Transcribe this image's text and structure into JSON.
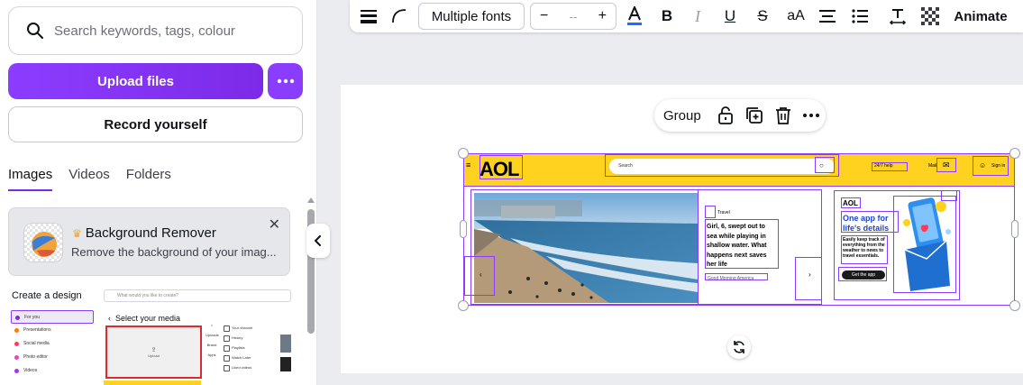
{
  "sidebar": {
    "search_placeholder": "Search keywords, tags, colour",
    "upload_label": "Upload files",
    "record_label": "Record yourself",
    "tabs": [
      {
        "label": "Images",
        "active": true
      },
      {
        "label": "Videos",
        "active": false
      },
      {
        "label": "Folders",
        "active": false
      }
    ],
    "bg_remover": {
      "title": "Background Remover",
      "description": "Remove the background of your imag..."
    },
    "preview": {
      "title": "Create a design",
      "search_placeholder": "What would you like to create?",
      "select_media": "Select your media",
      "upload_label": "Upload",
      "side_items": [
        "For you",
        "Presentations",
        "Social media",
        "Photo editor",
        "Videos"
      ],
      "side_colors": [
        "#7d2ae8",
        "#ff7a00",
        "#ff3b5c",
        "#e24bb3",
        "#ad34e3"
      ],
      "col2": [
        "Uploads",
        "Brand",
        "Apps"
      ],
      "col3": [
        "Your channel",
        "History",
        "Playlists",
        "Watch Later",
        "Liked videos"
      ]
    }
  },
  "toolbar": {
    "font": "Multiple fonts",
    "size_minus": "−",
    "size_value": "--",
    "size_plus": "+",
    "case_label": "aA",
    "animate_label": "Animate",
    "text_color": "#1d6cff"
  },
  "canvas": {
    "group_label": "Group",
    "aol": {
      "logo": "AOL",
      "search": "Search",
      "help": "24/7 help",
      "mail": "Mail",
      "signin": "Sign in",
      "story_tag": "Travel",
      "story": "Girl, 6, swept out to sea while playing in shallow water. What happens next saves her life",
      "story_source": "Good Morning America",
      "promo_logo": "AOL",
      "promo_title": "One app for life's details",
      "promo_text": "Easily keep track of everything from the weather to news to travel essentials.",
      "promo_btn": "Get the app"
    }
  },
  "colors": {
    "accent": "#8b3dff",
    "aol_yellow": "#ffd21f",
    "aol_blue": "#1d43d8"
  }
}
